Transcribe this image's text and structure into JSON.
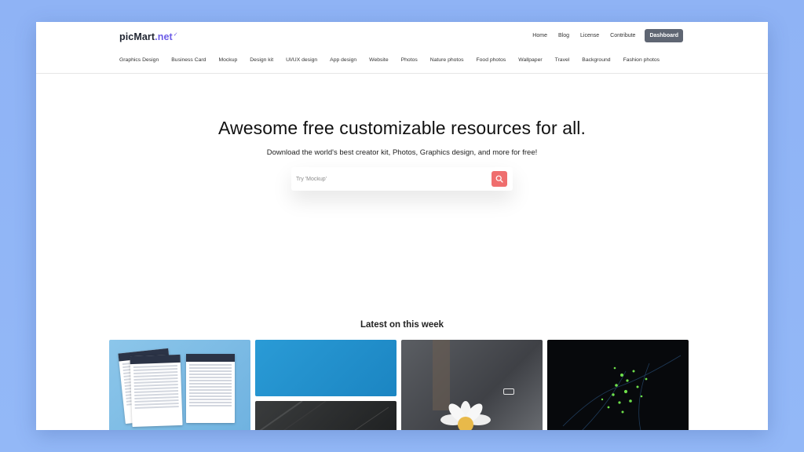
{
  "header": {
    "logo": {
      "name": "picMart",
      "suffix": ".net",
      "mark": "✓"
    },
    "nav": [
      "Home",
      "Blog",
      "License",
      "Contribute"
    ],
    "dashboard_label": "Dashboard"
  },
  "categories": [
    "Graphics Design",
    "Business Card",
    "Mockup",
    "Design kit",
    "UI/UX design",
    "App design",
    "Website",
    "Photos",
    "Nature photos",
    "Food photos",
    "Wallpaper",
    "Travel",
    "Background",
    "Fashion photos"
  ],
  "hero": {
    "title": "Awesome free customizable resources for all.",
    "subtitle": "Download the world's best creator kit, Photos, Graphics design, and more for free!"
  },
  "search": {
    "placeholder": "Try 'Mockup'",
    "value": "",
    "icon": "search-icon"
  },
  "latest": {
    "title": "Latest on this week",
    "items": [
      {
        "kind": "calendar-printable",
        "tone": "#7fbde6"
      },
      {
        "kind": "blue-texture",
        "tone": "#2196d3"
      },
      {
        "kind": "dark-texture",
        "tone": "#2b2d2e"
      },
      {
        "kind": "daisy-photo",
        "tone": "#4f5257"
      },
      {
        "kind": "green-lights",
        "tone": "#07090c"
      }
    ]
  },
  "colors": {
    "accent": "#6c5ce7",
    "search_button": "#ef6e6e",
    "dashboard_button": "#5f6673",
    "background": "#8fb3f5"
  }
}
